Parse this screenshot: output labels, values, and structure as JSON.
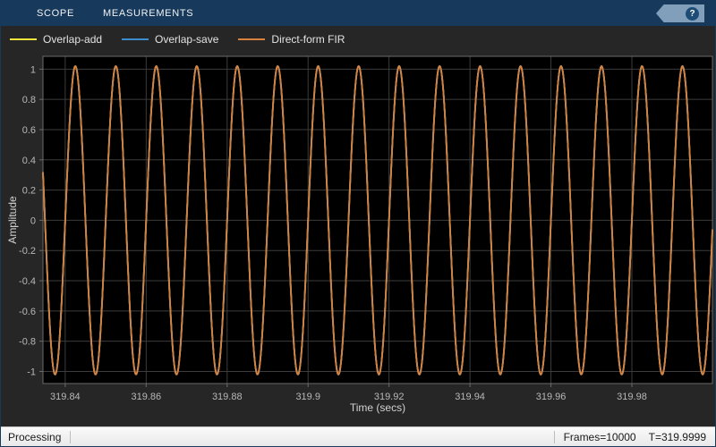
{
  "toolbar": {
    "tabs": [
      {
        "label": "SCOPE"
      },
      {
        "label": "MEASUREMENTS"
      }
    ],
    "help_label": "?"
  },
  "legend": {
    "items": [
      {
        "label": "Overlap-add",
        "color": "#f1e337"
      },
      {
        "label": "Overlap-save",
        "color": "#3b8ccc"
      },
      {
        "label": "Direct-form FIR",
        "color": "#d8813e"
      }
    ]
  },
  "chart_data": {
    "type": "line",
    "title": "",
    "xlabel": "Time (secs)",
    "ylabel": "Amplitude",
    "xlim": [
      319.8345,
      319.9999
    ],
    "ylim": [
      -1.08,
      1.085
    ],
    "x_ticks": [
      319.84,
      319.86,
      319.88,
      319.9,
      319.92,
      319.94,
      319.96,
      319.98
    ],
    "y_ticks": [
      -1,
      -0.8,
      -0.6,
      -0.4,
      -0.2,
      0,
      0.2,
      0.4,
      0.6,
      0.8,
      1
    ],
    "grid": true,
    "background_color": "#000000",
    "grid_color": "#3c3c3c",
    "axis_color": "#6a6a6a",
    "tick_label_color": "#b8b8b8",
    "legend_position": "top-left-outside",
    "note": "All three filtered sine waves coincide; the orange Direct-form FIR trace is drawn on top and hides the other two.",
    "series": [
      {
        "name": "Overlap-add",
        "color": "#f1e337",
        "waveform": {
          "type": "sine",
          "frequency_hz": 100,
          "amplitude": 1.02,
          "phase_zero_at": 319.84
        }
      },
      {
        "name": "Overlap-save",
        "color": "#3b8ccc",
        "waveform": {
          "type": "sine",
          "frequency_hz": 100,
          "amplitude": 1.02,
          "phase_zero_at": 319.84
        }
      },
      {
        "name": "Direct-form FIR",
        "color": "#d8813e",
        "waveform": {
          "type": "sine",
          "frequency_hz": 100,
          "amplitude": 1.02,
          "phase_zero_at": 319.84
        }
      }
    ]
  },
  "status_bar": {
    "left": "Processing",
    "frames": "Frames=10000",
    "time": "T=319.9999"
  }
}
